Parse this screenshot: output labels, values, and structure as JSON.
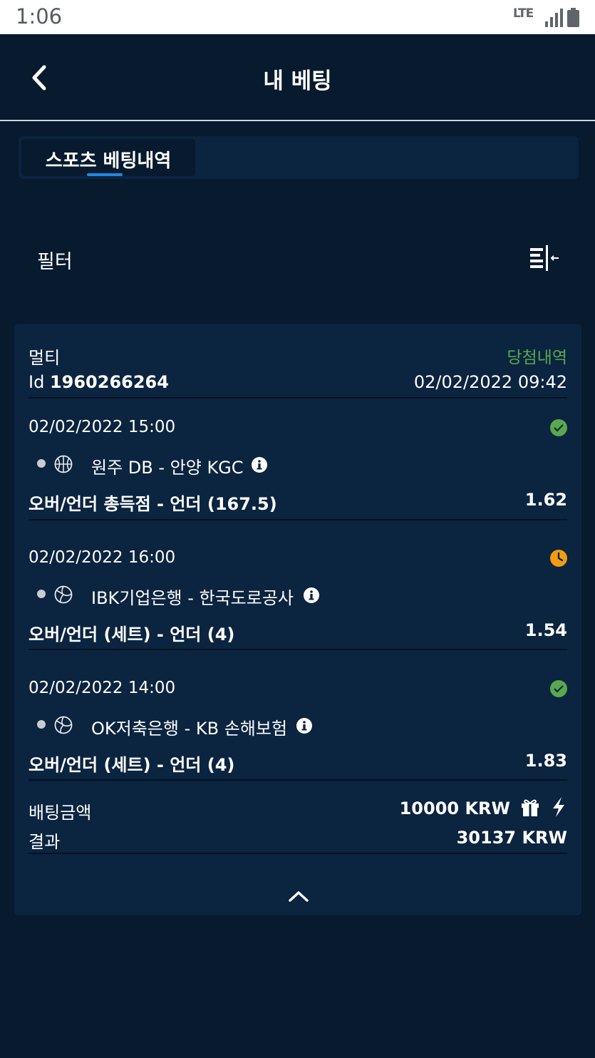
{
  "status_bar": {
    "time": "1:06",
    "network": "LTE"
  },
  "header": {
    "title": "내 베팅"
  },
  "tabs": [
    {
      "label": "스포츠 베팅내역",
      "active": true
    }
  ],
  "filter": {
    "label": "필터"
  },
  "bet": {
    "type": "멀티",
    "status": "당첨내역",
    "id_prefix": "Id",
    "id": "1960266264",
    "placed_at": "02/02/2022 09:42",
    "selections": [
      {
        "datetime": "02/02/2022 15:00",
        "sport_icon": "basketball-icon",
        "status_icon": "check-circle-icon",
        "match": "원주 DB - 안양 KGC",
        "market": "오버/언더 총득점 - 언더 (167.5)",
        "odds": "1.62"
      },
      {
        "datetime": "02/02/2022 16:00",
        "sport_icon": "volleyball-icon",
        "status_icon": "clock-icon",
        "match": "IBK기업은행 - 한국도로공사",
        "market": "오버/언더 (세트) - 언더 (4)",
        "odds": "1.54"
      },
      {
        "datetime": "02/02/2022 14:00",
        "sport_icon": "volleyball-icon",
        "status_icon": "check-circle-icon",
        "match": "OK저축은행 - KB 손해보험",
        "market": "오버/언더 (세트) - 언더 (4)",
        "odds": "1.83"
      }
    ],
    "stake_label": "배팅금액",
    "stake_value": "10000 KRW",
    "result_label": "결과",
    "result_value": "30137 KRW"
  },
  "colors": {
    "background": "#071a2e",
    "card": "#0b2440",
    "win_green": "#5aa84d",
    "pending_orange": "#f39c12",
    "tab_accent": "#1e88e5"
  }
}
